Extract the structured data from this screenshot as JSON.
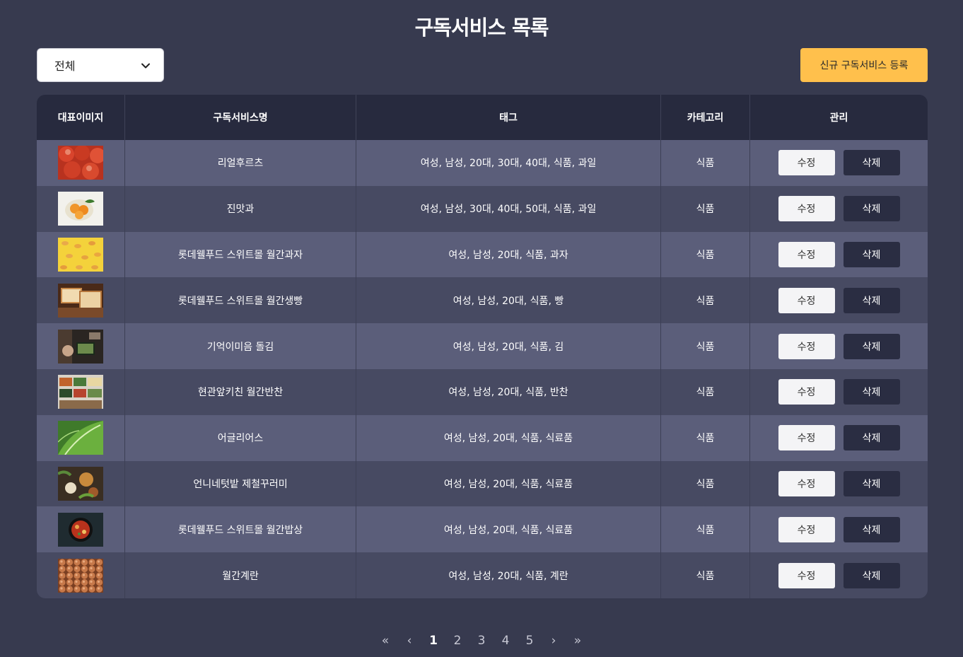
{
  "page_title": "구독서비스 목록",
  "filter": {
    "selected": "전체",
    "icon": "chevron-down-icon"
  },
  "register_button": "신규 구독서비스 등록",
  "table": {
    "headers": [
      "대표이미지",
      "구독서비스명",
      "태그",
      "카테고리",
      "관리"
    ],
    "rows": [
      {
        "image": "apples",
        "name": "리얼후르츠",
        "tags": "여성, 남성, 20대, 30대, 40대, 식품, 과일",
        "category": "식품",
        "edit": "수정",
        "delete": "삭제"
      },
      {
        "image": "tangerines",
        "name": "진맛과",
        "tags": "여성, 남성, 30대, 40대, 50대, 식품, 과일",
        "category": "식품",
        "edit": "수정",
        "delete": "삭제"
      },
      {
        "image": "snacks",
        "name": "롯데웰푸드 스위트몰 월간과자",
        "tags": "여성, 남성, 20대, 식품, 과자",
        "category": "식품",
        "edit": "수정",
        "delete": "삭제"
      },
      {
        "image": "bread",
        "name": "롯데웰푸드 스위트몰 월간생빵",
        "tags": "여성, 남성, 20대, 식품, 빵",
        "category": "식품",
        "edit": "수정",
        "delete": "삭제"
      },
      {
        "image": "seaweed",
        "name": "기억이미음 돌김",
        "tags": "여성, 남성, 20대, 식품, 김",
        "category": "식품",
        "edit": "수정",
        "delete": "삭제"
      },
      {
        "image": "side-dishes",
        "name": "현관앞키친 월간반찬",
        "tags": "여성, 남성, 20대, 식품, 반찬",
        "category": "식품",
        "edit": "수정",
        "delete": "삭제"
      },
      {
        "image": "lettuce",
        "name": "어글리어스",
        "tags": "여성, 남성, 20대, 식품, 식료품",
        "category": "식품",
        "edit": "수정",
        "delete": "삭제"
      },
      {
        "image": "vegetables",
        "name": "언니네텃밭 제철꾸러미",
        "tags": "여성, 남성, 20대, 식품, 식료품",
        "category": "식품",
        "edit": "수정",
        "delete": "삭제"
      },
      {
        "image": "meal-pan",
        "name": "롯데웰푸드 스위트몰 월간밥상",
        "tags": "여성, 남성, 20대, 식품, 식료품",
        "category": "식품",
        "edit": "수정",
        "delete": "삭제"
      },
      {
        "image": "eggs",
        "name": "월간계란",
        "tags": "여성, 남성, 20대, 식품, 계란",
        "category": "식품",
        "edit": "수정",
        "delete": "삭제"
      }
    ]
  },
  "pagination": {
    "first": "«",
    "prev": "‹",
    "pages": [
      "1",
      "2",
      "3",
      "4",
      "5"
    ],
    "current": "1",
    "next": "›",
    "last": "»"
  },
  "colors": {
    "background": "#373a4f",
    "header_bg": "#272a3e",
    "row_odd": "#5b5e7a",
    "row_even": "#474a62",
    "accent": "#ffc04c",
    "delete_btn": "#2a2d42"
  }
}
